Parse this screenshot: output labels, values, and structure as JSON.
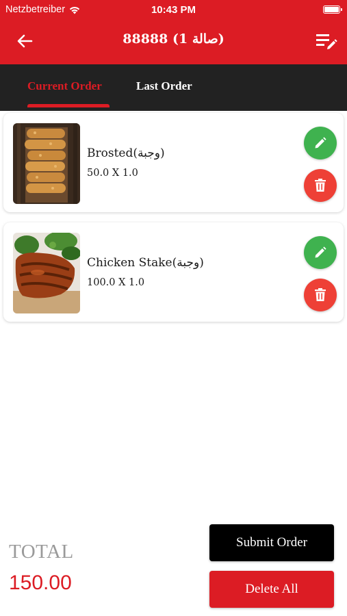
{
  "status_bar": {
    "carrier": "Netzbetreiber",
    "time": "10:43 PM"
  },
  "nav": {
    "title": "88888 (صالة 1)"
  },
  "tabs": [
    {
      "label": "Current Order"
    },
    {
      "label": "Last Order"
    }
  ],
  "items": [
    {
      "name": "Brosted(وجبة)",
      "qty_line": "50.0   X 1.0"
    },
    {
      "name": "Chicken Stake(وجبة)",
      "qty_line": "100.0   X 1.0"
    }
  ],
  "footer": {
    "total_label": "TOTAL",
    "total_value": "150.00",
    "submit_label": "Submit Order",
    "delete_all_label": "Delete All"
  },
  "colors": {
    "primary": "#dc1c24",
    "tab_bar": "#222222",
    "edit_green": "#3fb24f",
    "delete_red": "#ee4036"
  },
  "icons": [
    "wifi-icon",
    "battery-icon",
    "back-arrow-icon",
    "edit-list-icon",
    "pencil-icon",
    "trash-icon"
  ]
}
